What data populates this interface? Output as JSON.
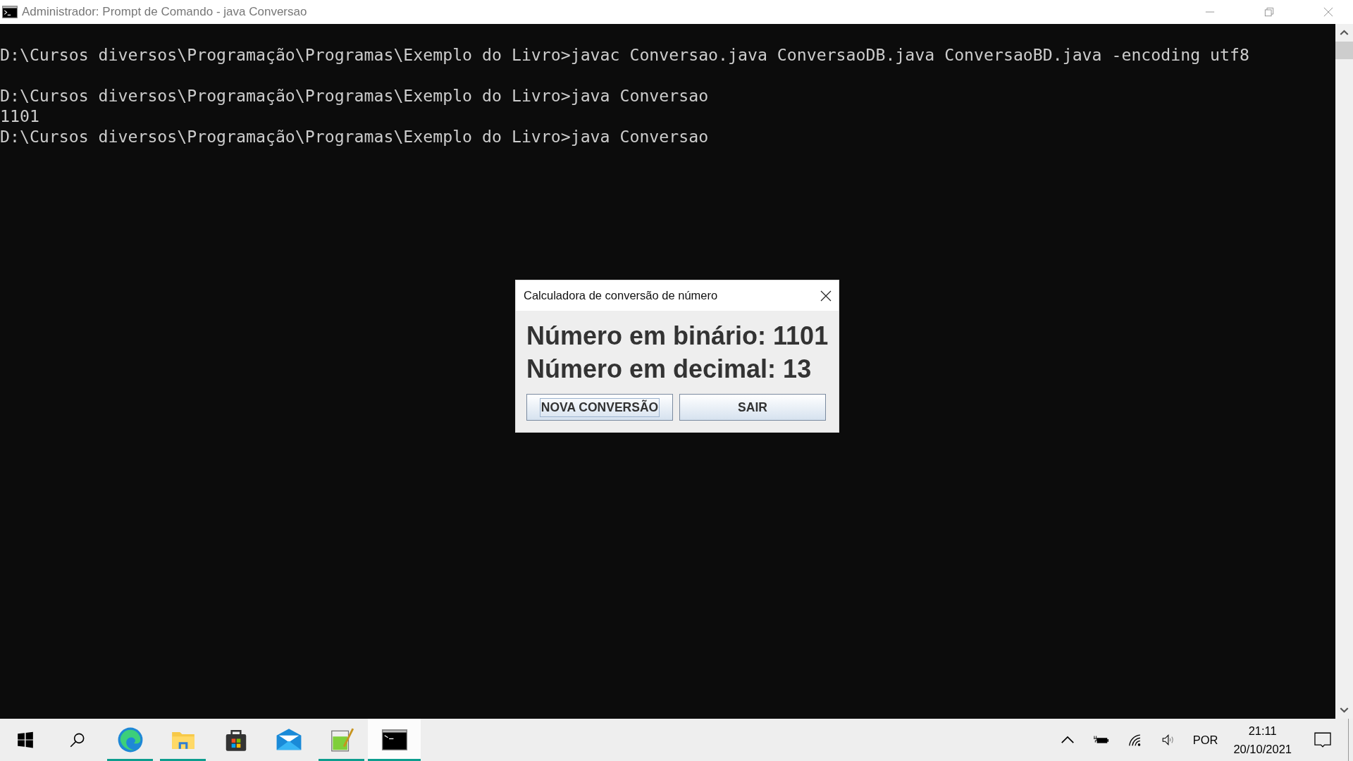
{
  "window": {
    "title": "Administrador: Prompt de Comando - java  Conversao"
  },
  "console": {
    "output": "\nD:\\Cursos diversos\\Programação\\Programas\\Exemplo do Livro>javac Conversao.java ConversaoDB.java ConversaoBD.java -encoding utf8\n\nD:\\Cursos diversos\\Programação\\Programas\\Exemplo do Livro>java Conversao\n1101\nD:\\Cursos diversos\\Programação\\Programas\\Exemplo do Livro>java Conversao"
  },
  "dialog": {
    "title": "Calculadora de conversão de número",
    "lines": [
      "Número em binário: 1101",
      "Número em decimal: 13"
    ],
    "buttons": [
      {
        "label": "NOVA CONVERSÃO",
        "focused": true
      },
      {
        "label": "SAIR",
        "focused": false
      }
    ]
  },
  "taskbar": {
    "apps": [
      {
        "kind": "start",
        "running": false,
        "active": false
      },
      {
        "kind": "search",
        "running": false,
        "active": false
      },
      {
        "kind": "browser",
        "running": true,
        "active": false
      },
      {
        "kind": "folder",
        "running": true,
        "active": false
      },
      {
        "kind": "store",
        "running": false,
        "active": false
      },
      {
        "kind": "mail",
        "running": false,
        "active": false
      },
      {
        "kind": "notepad",
        "running": true,
        "active": false
      },
      {
        "kind": "terminal",
        "running": true,
        "active": true
      }
    ],
    "language": "POR",
    "time": "21:11",
    "date": "20/10/2021"
  }
}
